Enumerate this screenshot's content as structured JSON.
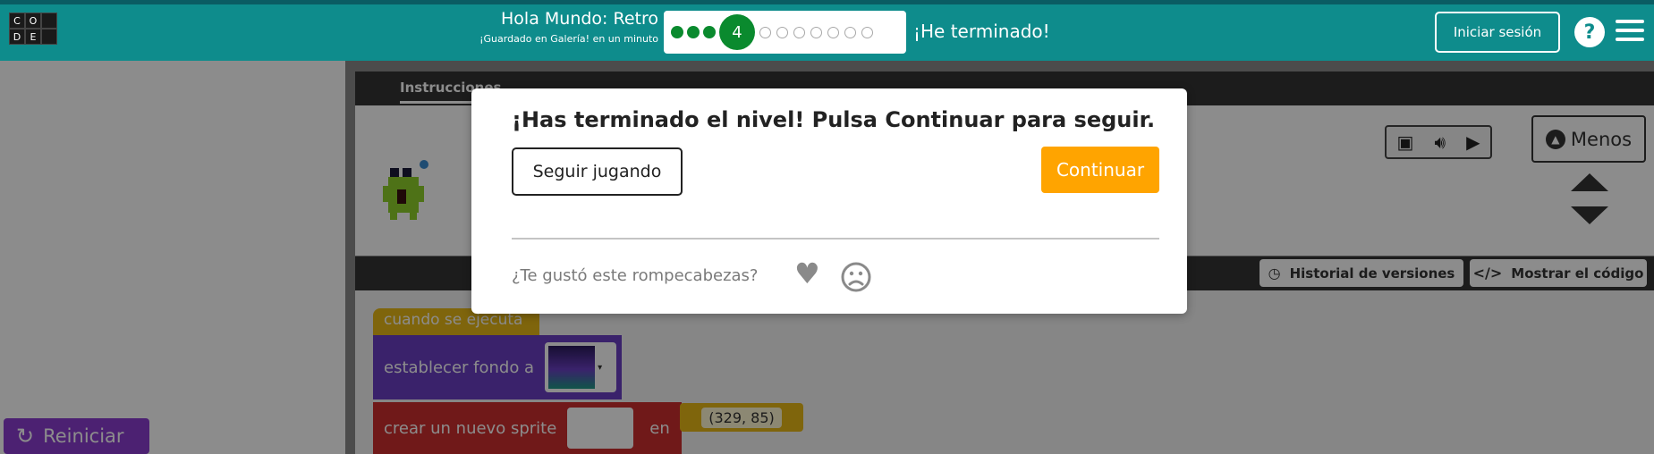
{
  "header": {
    "logo_letters": [
      "C",
      "O",
      "",
      "D",
      "E",
      ""
    ],
    "level_title": "Hola Mundo: Retro",
    "saved_status": "¡Guardado en Galería! en un minuto",
    "progress": {
      "completed": 3,
      "current_label": "4",
      "remaining": 7
    },
    "finished_label": "¡He terminado!",
    "signin_label": "Iniciar sesión",
    "help_label": "?"
  },
  "workspace": {
    "reset_label": "Reiniciar",
    "instructions_tab": "Instrucciones",
    "less_label": "Menos",
    "history_label": "Historial de versiones",
    "show_code_label": "Mostrar el código",
    "blocks": {
      "when_run": "cuando se ejecuta",
      "set_background": "establecer fondo a",
      "make_sprite": "crear un nuevo sprite",
      "at": "en",
      "coords": "(329, 85)"
    }
  },
  "dialog": {
    "title": "¡Has terminado el nivel! Pulsa Continuar para seguir.",
    "keep_playing_label": "Seguir jugando",
    "continue_label": "Continuar",
    "feedback_question": "¿Te gustó este rompecabezas?"
  },
  "colors": {
    "header": "#0e8c8c",
    "progress_done": "#0a8a2e",
    "continue": "#ffa400",
    "reset": "#8b3cd0"
  },
  "icons": [
    "hamburger-icon",
    "help-icon",
    "reset-icon",
    "speaker-icon",
    "play-icon",
    "chevron-up-icon",
    "clock-icon",
    "code-icon",
    "heart-icon",
    "frown-icon"
  ]
}
